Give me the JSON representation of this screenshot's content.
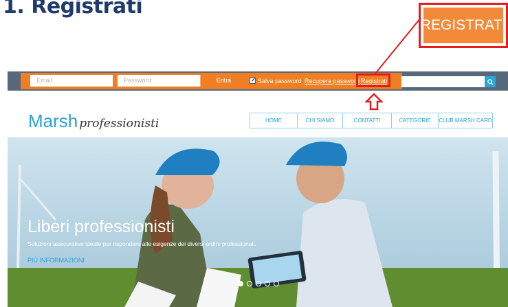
{
  "slide_title": "1. Registrati",
  "callout_label": "REGISTRATI",
  "topbar": {
    "email_placeholder": "Email",
    "password_placeholder": "Password",
    "login_button": "Entra",
    "save_password": "Salva password",
    "recover_password": "Recupera password",
    "register_link": "Registrati"
  },
  "logo": {
    "brand": "Marsh",
    "tagline": "professionisti"
  },
  "nav": [
    "HOME",
    "CHI SIAMO",
    "CONTATTI",
    "CATEGORIE",
    "CLUB MARSH CARD"
  ],
  "hero": {
    "title": "Liberi professionisti",
    "subtitle": "Soluzioni assicurative ideate per rispondere alle esigenze dei diversi ordini professionali.",
    "link": "PIÙ INFORMAZIONI",
    "slide_count": 5,
    "active_slide": 1
  },
  "colors": {
    "heading": "#1f3b6e",
    "accent_orange": "#ef7f22",
    "highlight_red": "#e21d1d",
    "brand_blue": "#2aa1d6",
    "topbar_gray": "#56687a"
  },
  "icons": [
    "search-icon",
    "checkbox-checked-icon",
    "up-arrow-icon"
  ]
}
